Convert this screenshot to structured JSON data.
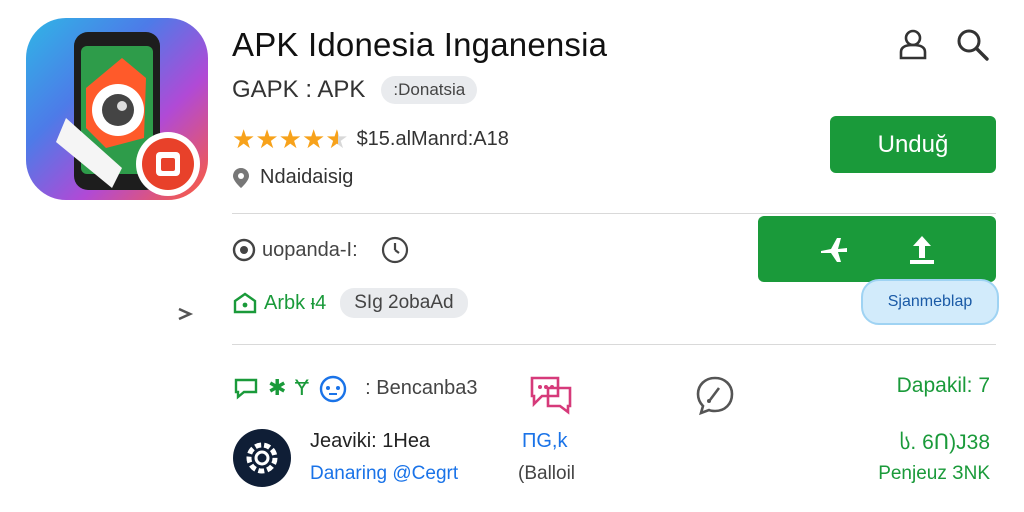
{
  "header": {
    "title": "APK Idonesia Inganensia",
    "subtitle": "GAPK : APK",
    "chip": ":Donatsia",
    "rating": {
      "stars": 4.5,
      "text": "$15.alManrd:A18"
    },
    "location": "Ndaidaisig"
  },
  "top_actions": {
    "account_icon": "person-icon",
    "search_icon": "search-icon"
  },
  "buttons": {
    "download_label": "Unduğ",
    "secondary_label": "Sjanmeblap"
  },
  "info_row": {
    "label": "uopanda-I:",
    "badge_text": "Arbk ᵼ4",
    "badge_chip": "SIg 2obaAd"
  },
  "bottom": {
    "row1_label": ": Bencanba3",
    "row1_right": "Dapakil: 7",
    "app_name": "Jeaviki: 1Hea",
    "app_sub": "Danaring @Cegrt",
    "mid_code": "ПG,k",
    "mid_sub": "(Balloil",
    "right_value": "ს. 6Ո)J38",
    "right_sub": "Penjeuz ЗNK"
  },
  "colors": {
    "green": "#1a9a3a",
    "star": "#f7a21b",
    "blue": "#1a73e8",
    "pink": "#d63a7a"
  }
}
